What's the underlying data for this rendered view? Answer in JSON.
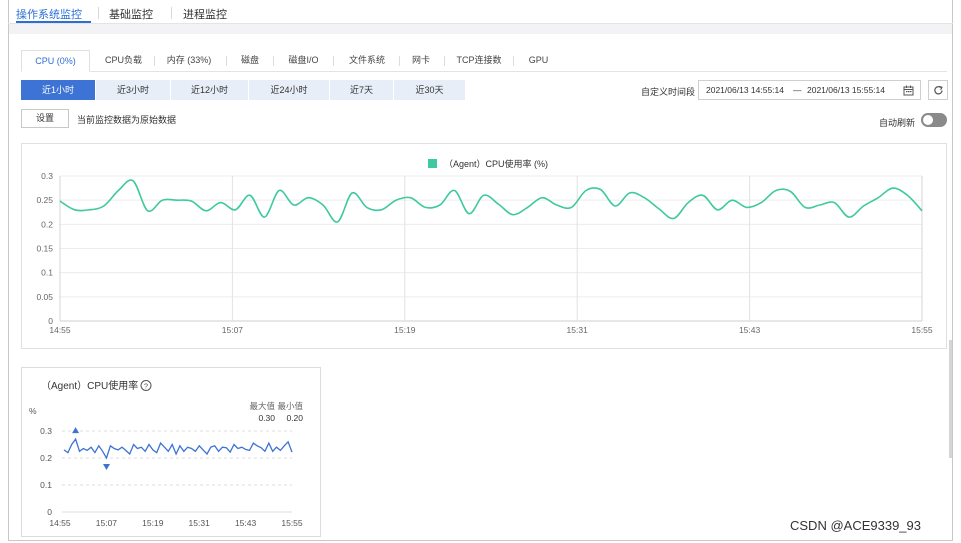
{
  "top_tabs": [
    "操作系统监控",
    "基础监控",
    "进程监控"
  ],
  "sub_tabs": [
    "CPU (0%)",
    "CPU负载",
    "内存 (33%)",
    "磁盘",
    "磁盘I/O",
    "文件系统",
    "网卡",
    "TCP连接数",
    "GPU"
  ],
  "time_ranges": [
    "近1小时",
    "近3小时",
    "近12小时",
    "近24小时",
    "近7天",
    "近30天"
  ],
  "custom_range": {
    "label": "自定义时间段",
    "start": "2021/06/13 14:55:14",
    "separator": "—",
    "end": "2021/06/13 15:55:14"
  },
  "settings_button": "设置",
  "data_note": "当前监控数据为原始数据",
  "auto_refresh_label": "自动刷新",
  "auto_refresh_on": false,
  "accent_color": "#3c73d4",
  "series_color": "#3ec9a0",
  "chart_data": [
    {
      "type": "line",
      "legend": "（Agent）CPU使用率 (%)",
      "legend_placement": "top-center",
      "grid": true,
      "ylim": [
        0,
        0.3
      ],
      "y_ticks": [
        "0",
        "0.05",
        "0.1",
        "0.15",
        "0.2",
        "0.25",
        "0.3"
      ],
      "x_ticks": [
        "14:55",
        "15:07",
        "15:19",
        "15:31",
        "15:43",
        "15:55"
      ],
      "x": [
        0,
        1,
        2,
        3,
        4,
        5,
        6,
        7,
        8,
        9,
        10,
        11,
        12,
        13,
        14,
        15,
        16,
        17,
        18,
        19,
        20,
        21,
        22,
        23,
        24,
        25,
        26,
        27,
        28,
        29,
        30,
        31,
        32,
        33,
        34,
        35,
        36,
        37,
        38,
        39,
        40,
        41,
        42,
        43,
        44,
        45,
        46,
        47,
        48,
        49,
        50,
        51,
        52,
        53,
        54,
        55,
        56,
        57,
        58,
        59
      ],
      "series": [
        {
          "values": [
            0.248,
            0.23,
            0.23,
            0.238,
            0.27,
            0.29,
            0.228,
            0.25,
            0.25,
            0.248,
            0.228,
            0.245,
            0.23,
            0.26,
            0.215,
            0.27,
            0.24,
            0.255,
            0.24,
            0.205,
            0.265,
            0.235,
            0.23,
            0.25,
            0.255,
            0.235,
            0.24,
            0.27,
            0.222,
            0.26,
            0.242,
            0.22,
            0.235,
            0.255,
            0.24,
            0.235,
            0.27,
            0.272,
            0.238,
            0.265,
            0.255,
            0.232,
            0.212,
            0.245,
            0.26,
            0.23,
            0.25,
            0.235,
            0.245,
            0.27,
            0.268,
            0.235,
            0.24,
            0.245,
            0.215,
            0.238,
            0.255,
            0.275,
            0.26,
            0.228
          ]
        }
      ]
    },
    {
      "type": "line",
      "title": "（Agent）CPU使用率",
      "y_unit": "%",
      "ylim": [
        0,
        0.3
      ],
      "y_ticks": [
        "0",
        "0.1",
        "0.2",
        "0.3"
      ],
      "x_ticks": [
        "14:55",
        "15:07",
        "15:19",
        "15:31",
        "15:43",
        "15:55"
      ],
      "max_label": "最大值",
      "min_label": "最小值",
      "max_value": "0.30",
      "min_value": "0.20",
      "x": [
        0,
        1,
        2,
        3,
        4,
        5,
        6,
        7,
        8,
        9,
        10,
        11,
        12,
        13,
        14,
        15,
        16,
        17,
        18,
        19,
        20,
        21,
        22,
        23,
        24,
        25,
        26,
        27,
        28,
        29,
        30,
        31,
        32,
        33,
        34,
        35,
        36,
        37,
        38,
        39,
        40,
        41,
        42,
        43,
        44,
        45,
        46,
        47,
        48,
        49,
        50,
        51,
        52,
        53,
        54,
        55,
        56,
        57,
        58,
        59
      ],
      "series": [
        {
          "values": [
            0.23,
            0.22,
            0.25,
            0.27,
            0.225,
            0.235,
            0.228,
            0.24,
            0.22,
            0.245,
            0.225,
            0.2,
            0.245,
            0.235,
            0.23,
            0.24,
            0.228,
            0.215,
            0.25,
            0.235,
            0.24,
            0.225,
            0.25,
            0.23,
            0.22,
            0.255,
            0.24,
            0.225,
            0.25,
            0.215,
            0.245,
            0.225,
            0.24,
            0.235,
            0.225,
            0.245,
            0.23,
            0.215,
            0.24,
            0.245,
            0.225,
            0.24,
            0.238,
            0.222,
            0.25,
            0.235,
            0.24,
            0.232,
            0.228,
            0.255,
            0.245,
            0.238,
            0.225,
            0.255,
            0.225,
            0.24,
            0.228,
            0.245,
            0.26,
            0.222
          ]
        }
      ]
    }
  ],
  "watermark": "CSDN @ACE9339_93"
}
